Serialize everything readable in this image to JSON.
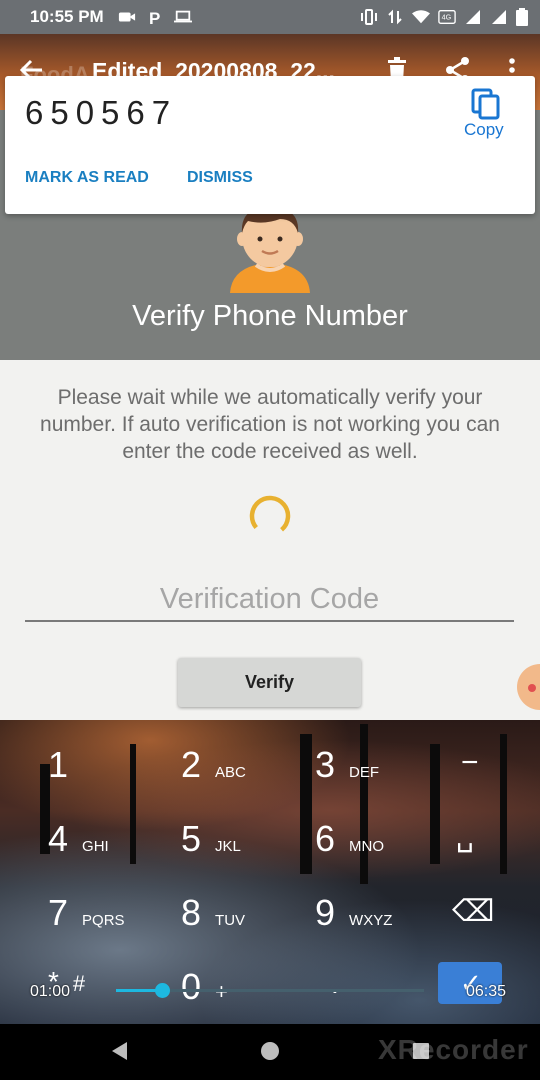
{
  "status_bar": {
    "time": "10:55 PM",
    "left_icons": [
      "video-camera-icon",
      "parking-icon",
      "laptop-icon"
    ],
    "right_icons": [
      "vibrate-icon",
      "data-arrows-icon",
      "wifi-icon",
      "volte-icon",
      "signal-icon",
      "signal-icon",
      "battery-icon"
    ]
  },
  "player_bar": {
    "title": "Edited_20200808_22...",
    "app_ghost": "FoodA",
    "actions": [
      "back-arrow-icon",
      "delete-icon",
      "share-icon",
      "more-vert-icon"
    ]
  },
  "notification": {
    "otp": "650567",
    "copy_label": "Copy",
    "mark_read_label": "MARK AS READ",
    "dismiss_label": "DISMISS"
  },
  "verify_screen": {
    "title": "Verify Phone Number",
    "message": "Please wait while we automatically verify your number. If auto verification is not working you can enter the code received as well.",
    "code_placeholder": "Verification Code",
    "code_value": "",
    "verify_label": "Verify"
  },
  "keypad": {
    "keys": [
      {
        "num": "1",
        "letters": ""
      },
      {
        "num": "2",
        "letters": "ABC"
      },
      {
        "num": "3",
        "letters": "DEF"
      },
      {
        "num": "−",
        "letters": ""
      },
      {
        "num": "4",
        "letters": "GHI"
      },
      {
        "num": "5",
        "letters": "JKL"
      },
      {
        "num": "6",
        "letters": "MNO"
      },
      {
        "num": "␣",
        "letters": ""
      },
      {
        "num": "7",
        "letters": "PQRS"
      },
      {
        "num": "8",
        "letters": "TUV"
      },
      {
        "num": "9",
        "letters": "WXYZ"
      },
      {
        "num": "⌫",
        "letters": ""
      },
      {
        "num": "*",
        "letters": "#"
      },
      {
        "num": "0",
        "letters": "+"
      },
      {
        "num": ".",
        "letters": ""
      },
      {
        "num": "✓",
        "letters": ""
      }
    ]
  },
  "recorder": {
    "current_time": "01:00",
    "total_time": "06:35",
    "progress": 0.15,
    "watermark": "XRecorder"
  },
  "colors": {
    "accent_blue": "#1a7fc1",
    "header_gray": "#7b7e7c",
    "spinner": "#e8b130",
    "seek": "#1db8e0"
  }
}
